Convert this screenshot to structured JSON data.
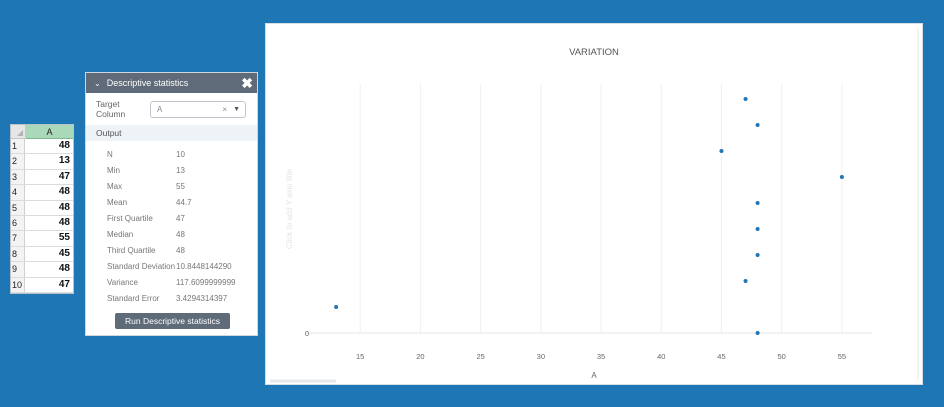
{
  "sheet": {
    "column_header": "A",
    "rows": [
      {
        "n": "1",
        "v": "48"
      },
      {
        "n": "2",
        "v": "13"
      },
      {
        "n": "3",
        "v": "47"
      },
      {
        "n": "4",
        "v": "48"
      },
      {
        "n": "5",
        "v": "48"
      },
      {
        "n": "6",
        "v": "48"
      },
      {
        "n": "7",
        "v": "55"
      },
      {
        "n": "8",
        "v": "45"
      },
      {
        "n": "9",
        "v": "48"
      },
      {
        "n": "10",
        "v": "47"
      }
    ]
  },
  "dialog": {
    "title": "Descriptive statistics",
    "chevron_icon": "chevron-down-icon",
    "close_icon": "close-icon",
    "target_label": "Target Column",
    "target_value": "A",
    "output_label": "Output",
    "stats": [
      {
        "label": "N",
        "value": "10"
      },
      {
        "label": "Min",
        "value": "13"
      },
      {
        "label": "Max",
        "value": "55"
      },
      {
        "label": "Mean",
        "value": "44.7"
      },
      {
        "label": "First Quartile",
        "value": "47"
      },
      {
        "label": "Median",
        "value": "48"
      },
      {
        "label": "Third Quartile",
        "value": "48"
      },
      {
        "label": "Standard Deviation",
        "value": "10.8448144290"
      },
      {
        "label": "Variance",
        "value": "117.6099999999"
      },
      {
        "label": "Standard Error",
        "value": "3.4294314397"
      }
    ],
    "run_button": "Run Descriptive statistics"
  },
  "colors": {
    "background": "#1f76b4",
    "accent": "#5f6b79",
    "point": "#1f77b4"
  },
  "chart_data": {
    "type": "scatter",
    "title": "VARIATION",
    "xlabel": "A",
    "ylabel": "Click to add Y axis title",
    "xlim": [
      10.5,
      57.5
    ],
    "xticks": [
      15,
      20,
      25,
      30,
      35,
      40,
      45,
      50,
      55
    ],
    "yticks": [
      "0"
    ],
    "points": [
      {
        "x": 47,
        "row": 1
      },
      {
        "x": 48,
        "row": 2
      },
      {
        "x": 45,
        "row": 3
      },
      {
        "x": 55,
        "row": 4
      },
      {
        "x": 48,
        "row": 5
      },
      {
        "x": 48,
        "row": 6
      },
      {
        "x": 48,
        "row": 7
      },
      {
        "x": 47,
        "row": 8
      },
      {
        "x": 13,
        "row": 9
      },
      {
        "x": 48,
        "row": 10
      }
    ]
  }
}
